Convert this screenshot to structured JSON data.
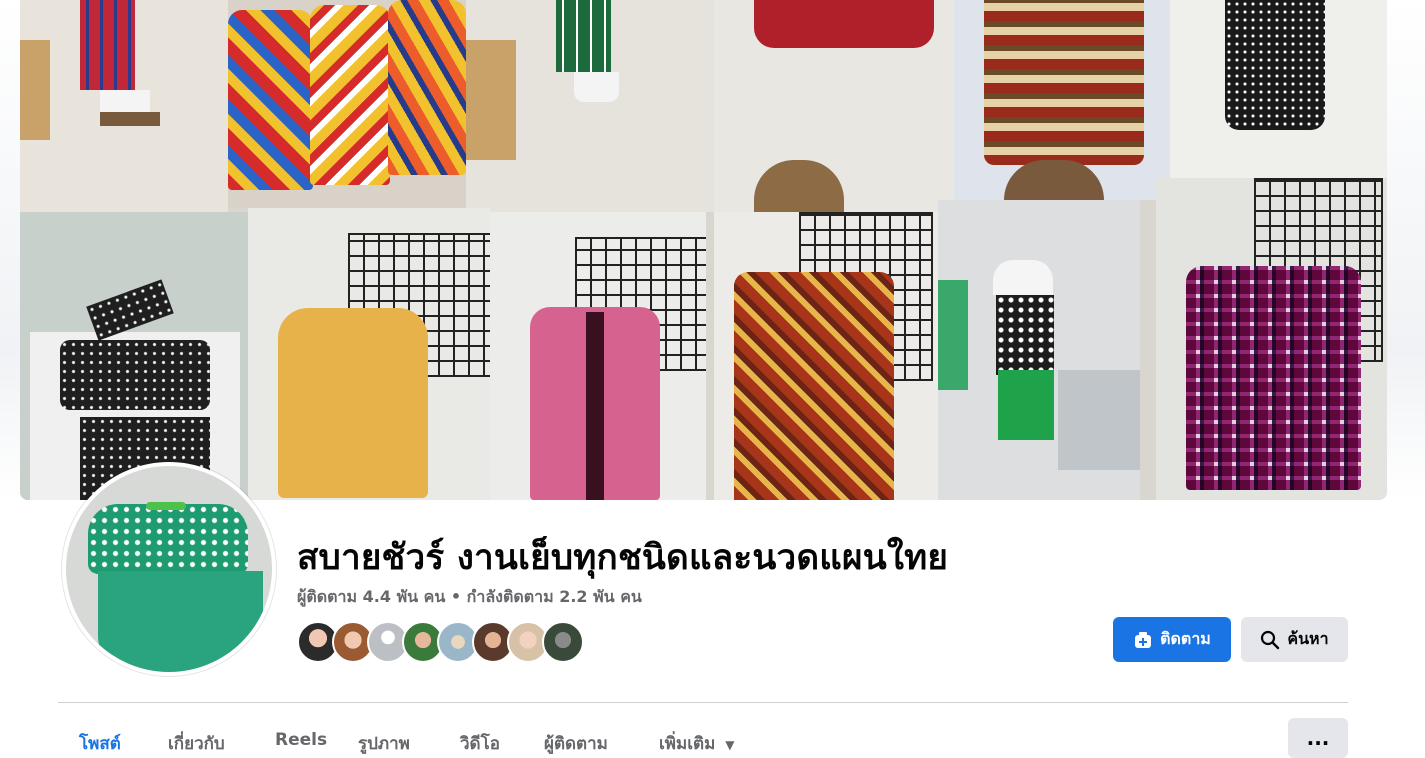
{
  "page": {
    "name": "สบายชัวร์ งานเย็บทุกชนิดและนวดแผนใทย",
    "followers": "ผู้ติดตาม 4.4 พัน คน",
    "separator": "•",
    "following": "กำลังติดตาม 2.2 พัน คน"
  },
  "actions": {
    "follow_label": "ติดตาม",
    "search_label": "ค้นหา"
  },
  "tabs": [
    {
      "label": "โพสต์",
      "active": true
    },
    {
      "label": "เกี่ยวกับ",
      "active": false
    },
    {
      "label": "Reels",
      "active": false
    },
    {
      "label": "รูปภาพ",
      "active": false
    },
    {
      "label": "วิดีโอ",
      "active": false
    },
    {
      "label": "ผู้ติดตาม",
      "active": false
    },
    {
      "label": "เพิ่มเติม",
      "active": false
    }
  ],
  "more_button_label": "...",
  "colors": {
    "accent": "#1b74e4",
    "secondary_button": "#e4e6eb",
    "muted_text": "#65676b"
  }
}
